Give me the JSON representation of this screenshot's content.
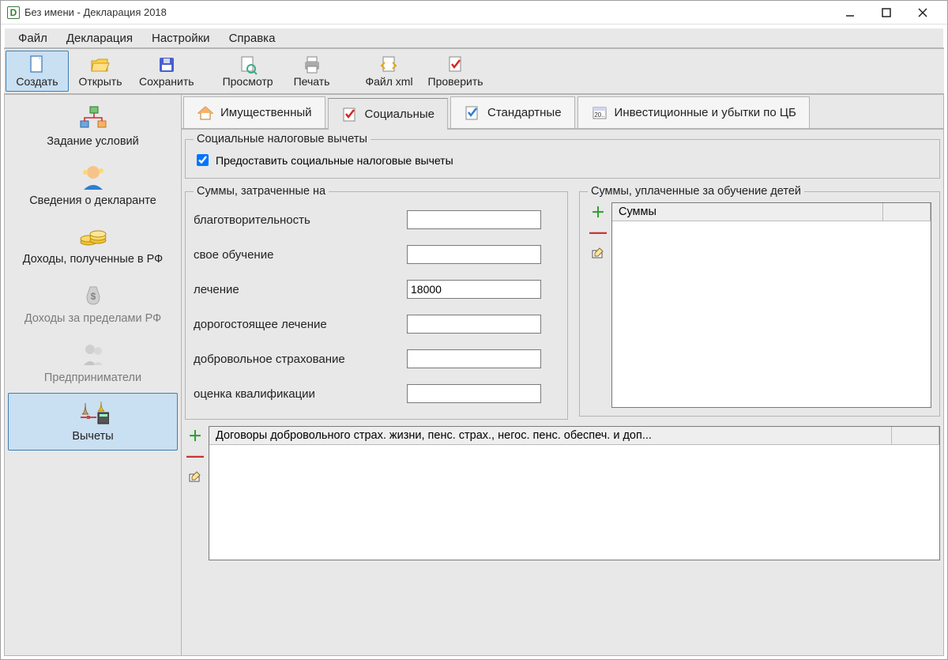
{
  "window": {
    "title": "Без имени - Декларация 2018"
  },
  "menu": {
    "file": "Файл",
    "decl": "Декларация",
    "settings": "Настройки",
    "help": "Справка"
  },
  "toolbar": {
    "create": "Создать",
    "open": "Открыть",
    "save": "Сохранить",
    "preview": "Просмотр",
    "print": "Печать",
    "filexml": "Файл xml",
    "check": "Проверить"
  },
  "sidebar": {
    "items": [
      {
        "label": "Задание условий",
        "disabled": false
      },
      {
        "label": "Сведения о декларанте",
        "disabled": false
      },
      {
        "label": "Доходы, полученные в РФ",
        "disabled": false
      },
      {
        "label": "Доходы за пределами РФ",
        "disabled": true
      },
      {
        "label": "Предприниматели",
        "disabled": true
      },
      {
        "label": "Вычеты",
        "disabled": false,
        "selected": true
      }
    ]
  },
  "tabs": {
    "property": "Имущественный",
    "social": "Социальные",
    "standard": "Стандартные",
    "invest": "Инвестиционные и убытки по ЦБ"
  },
  "groups": {
    "main_title": "Социальные налоговые вычеты",
    "provide_checkbox": "Предоставить социальные налоговые вычеты",
    "provide_checked": true,
    "spent_title": "Суммы, затраченные на",
    "children_title": "Суммы, уплаченные за обучение детей",
    "children_col": "Суммы",
    "contracts_col": "Договоры добровольного страх. жизни, пенс. страх., негос. пенс. обеспеч. и доп..."
  },
  "fields": {
    "charity": {
      "label": "благотворительность",
      "value": ""
    },
    "own_edu": {
      "label": "свое обучение",
      "value": ""
    },
    "treatment": {
      "label": "лечение",
      "value": "18000"
    },
    "exp_treatment": {
      "label": "дорогостоящее лечение",
      "value": ""
    },
    "insurance": {
      "label": "добровольное страхование",
      "value": ""
    },
    "qualif": {
      "label": "оценка квалификации",
      "value": ""
    }
  }
}
